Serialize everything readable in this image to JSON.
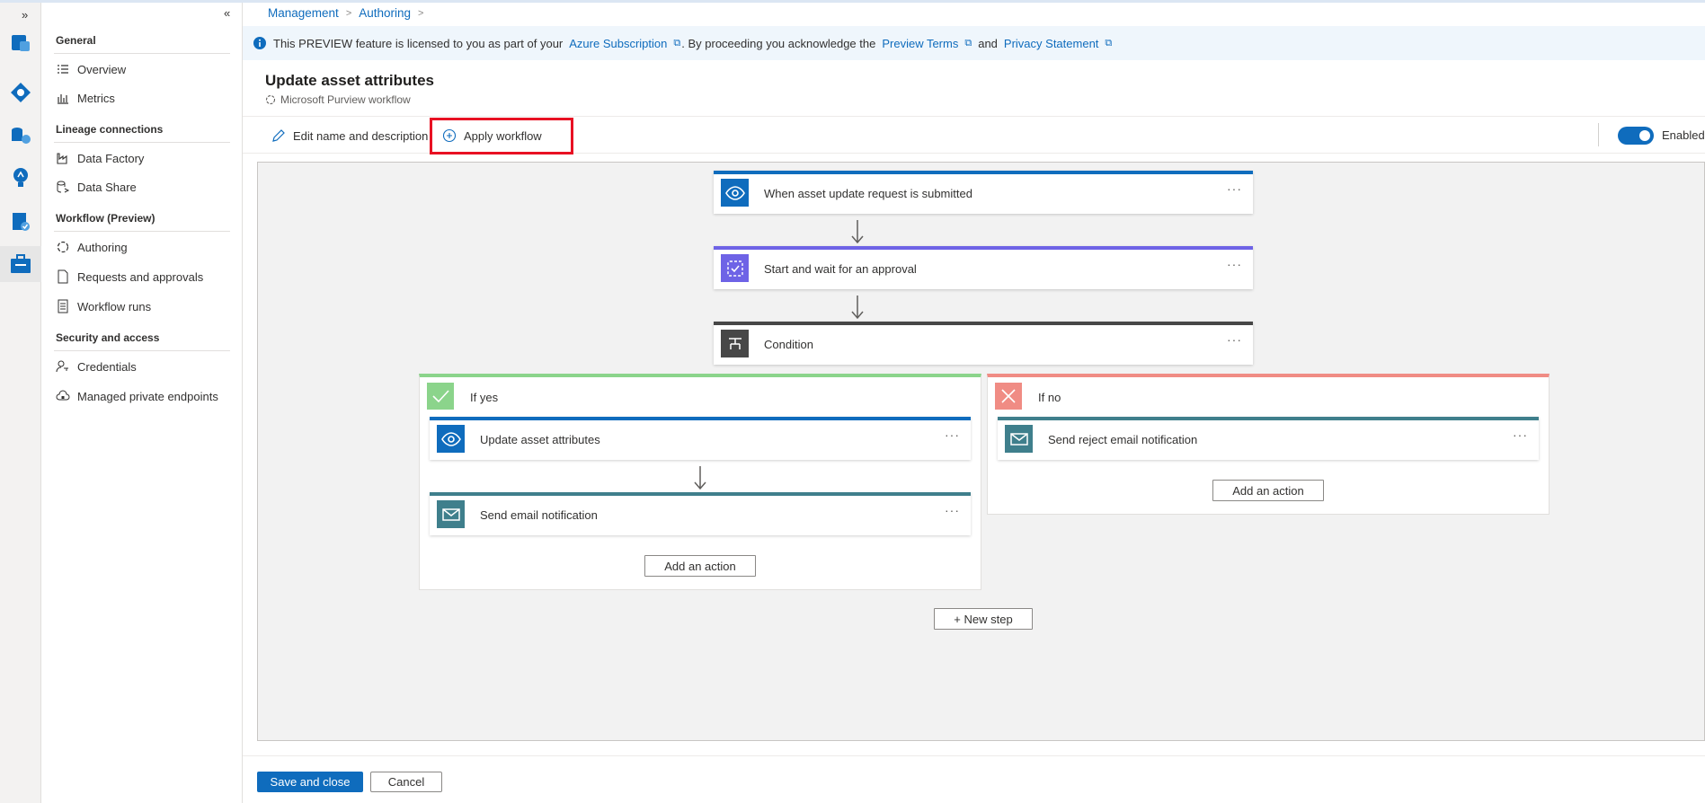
{
  "rail": {
    "expand_glyph": "»",
    "icons": [
      "data-catalog-icon",
      "data-map-icon",
      "data-estate-icon",
      "insights-icon",
      "policy-icon",
      "management-icon"
    ]
  },
  "nav": {
    "collapse_glyph": "«",
    "sections": {
      "general": "General",
      "lineage": "Lineage connections",
      "workflow": "Workflow (Preview)",
      "security": "Security and access"
    },
    "items": {
      "overview": "Overview",
      "metrics": "Metrics",
      "data_factory": "Data Factory",
      "data_share": "Data Share",
      "authoring": "Authoring",
      "requests": "Requests and approvals",
      "workflow_runs": "Workflow runs",
      "credentials": "Credentials",
      "private_endpoints": "Managed private endpoints"
    }
  },
  "breadcrumb": {
    "item1": "Management",
    "item2": "Authoring",
    "sep": ">"
  },
  "banner": {
    "text1": "This PREVIEW feature is licensed to you as part of your",
    "link1": "Azure Subscription",
    "text2": ". By proceeding you acknowledge the",
    "link2": "Preview Terms",
    "text3": "and",
    "link3": "Privacy Statement"
  },
  "page": {
    "title": "Update asset attributes",
    "subtitle": "Microsoft Purview workflow"
  },
  "toolbar": {
    "edit_label": "Edit name and description",
    "apply_label": "Apply workflow",
    "toggle_label": "Enabled",
    "enabled": true
  },
  "workflow": {
    "step1": "When asset update request is submitted",
    "step2": "Start and wait for an approval",
    "step3": "Condition",
    "more_glyph": "···",
    "yes_branch": {
      "title": "If yes",
      "action1": "Update asset attributes",
      "action2": "Send email notification",
      "add_action": "Add an action"
    },
    "no_branch": {
      "title": "If no",
      "action1": "Send reject email notification",
      "add_action": "Add an action"
    },
    "new_step": "+ New step"
  },
  "footer": {
    "save_label": "Save and close",
    "cancel_label": "Cancel"
  },
  "colors": {
    "accent": "#0f6cbd",
    "approval": "#6e63e6",
    "condition": "#474747",
    "yes": "#8bd48b",
    "no": "#f08c84",
    "email": "#3f7f8c",
    "highlight": "#e81123"
  }
}
